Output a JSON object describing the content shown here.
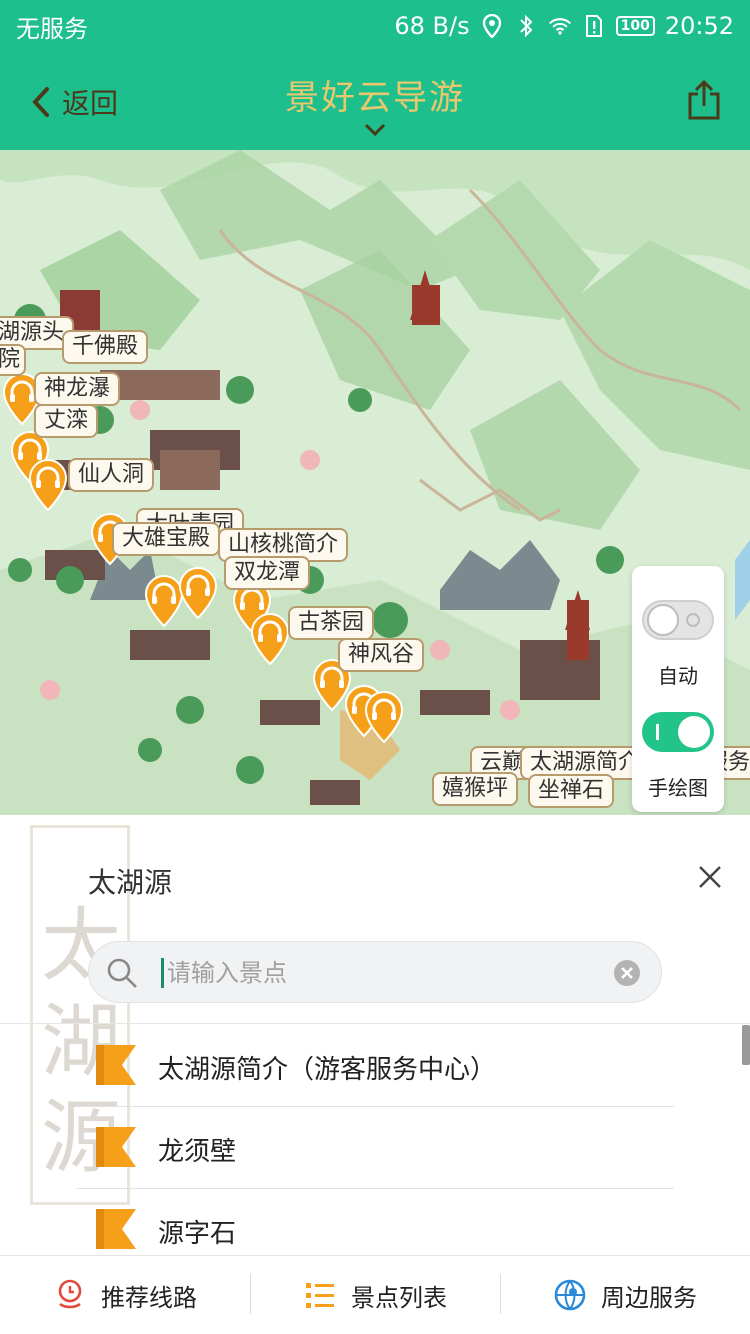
{
  "statusbar": {
    "carrier": "无服务",
    "network_speed": "68 B/s",
    "battery": "100",
    "time": "20:52"
  },
  "header": {
    "back_label": "返回",
    "title": "景好云导游"
  },
  "map": {
    "labels": [
      "湖源头",
      "千佛殿",
      "院",
      "神龙瀑",
      "丈滦",
      "仙人洞",
      "大雄宝殿",
      "大叶青园",
      "山核桃简介",
      "双龙潭",
      "古茶园",
      "神风谷",
      "嬉猴坪",
      "坐禅石",
      "太湖源简介（游客服务中心）",
      "云巅"
    ],
    "toggles": {
      "auto_label": "自动",
      "auto_on": false,
      "handdrawn_label": "手绘图",
      "handdrawn_on": true
    }
  },
  "sheet": {
    "title": "太湖源",
    "bg_text": "太湖源",
    "search_placeholder": "请输入景点",
    "items": [
      {
        "name": "太湖源简介（游客服务中心）"
      },
      {
        "name": "龙须壁"
      },
      {
        "name": "源字石"
      }
    ]
  },
  "nav": {
    "route": "推荐线路",
    "list": "景点列表",
    "nearby": "周边服务"
  },
  "colors": {
    "primary": "#1dbf8d",
    "title_gold": "#e9c86d",
    "pin_orange": "#f5a018",
    "toggle_green": "#22c489"
  }
}
